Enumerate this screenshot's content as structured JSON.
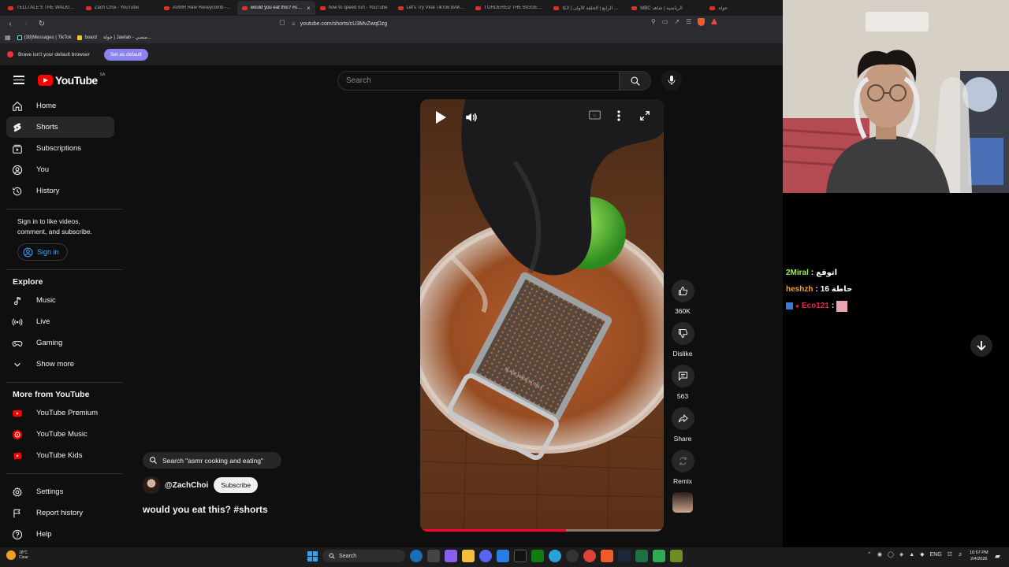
{
  "browser": {
    "tabs": [
      {
        "title": "TELLTALE'S THE WALKING DEA",
        "active": false
      },
      {
        "title": "Zach Choi - YouTube",
        "active": false
      },
      {
        "title": "ASMR Raw Honeycomb - Extr",
        "active": false
      },
      {
        "title": "would you eat this? #short",
        "active": true
      },
      {
        "title": "how to speed run - YouTube",
        "active": false
      },
      {
        "title": "Let's Try Viral TikTok BAKED P",
        "active": false
      },
      {
        "title": "I ORDERED THE BIGGEST BUR",
        "active": false
      },
      {
        "title": "الوزن الرابع | الحلقة الأولى | الكا",
        "active": false
      },
      {
        "title": "MBC الرياضية | شاهد",
        "active": false
      },
      {
        "title": "حولة",
        "active": false
      }
    ],
    "url": "youtube.com/shorts/cU3MvZwqDzg",
    "bookmarks": [
      "(38)Messages | TikTok",
      "board",
      "جولة | Jawlah - منصي..."
    ],
    "notice_text": "Brave isn't your default browser",
    "notice_button": "Set as default"
  },
  "youtube": {
    "logo_text": "YouTube",
    "country_code": "SA",
    "search_placeholder": "Search",
    "sidebar": {
      "main": [
        {
          "label": "Home",
          "icon": "home-icon",
          "active": false
        },
        {
          "label": "Shorts",
          "icon": "shorts-icon",
          "active": true
        },
        {
          "label": "Subscriptions",
          "icon": "subscriptions-icon",
          "active": false
        },
        {
          "label": "You",
          "icon": "you-icon",
          "active": false
        },
        {
          "label": "History",
          "icon": "history-icon",
          "active": false
        }
      ],
      "sign_in_text": "Sign in to like videos, comment, and subscribe.",
      "sign_in_button": "Sign in",
      "explore_title": "Explore",
      "explore": [
        {
          "label": "Music",
          "icon": "music-icon"
        },
        {
          "label": "Live",
          "icon": "live-icon"
        },
        {
          "label": "Gaming",
          "icon": "gaming-icon"
        },
        {
          "label": "Show more",
          "icon": "chevron-down-icon"
        }
      ],
      "more_title": "More from YouTube",
      "more": [
        {
          "label": "YouTube Premium",
          "icon": "youtube-premium-icon"
        },
        {
          "label": "YouTube Music",
          "icon": "youtube-music-icon"
        },
        {
          "label": "YouTube Kids",
          "icon": "youtube-kids-icon"
        }
      ],
      "footer": [
        {
          "label": "Settings",
          "icon": "settings-icon"
        },
        {
          "label": "Report history",
          "icon": "flag-icon"
        },
        {
          "label": "Help",
          "icon": "help-icon"
        }
      ]
    },
    "short": {
      "grater_text": "BLADE MADE IN ITALY",
      "progress": 0.6,
      "search_chip": "Search \"asmr cooking and eating\"",
      "channel": "@ZachChoi",
      "subscribe": "Subscribe",
      "title": "would you eat this? #shorts",
      "actions": [
        {
          "key": "like",
          "label": "360K",
          "icon": "thumbs-up-icon"
        },
        {
          "key": "dislike",
          "label": "Dislike",
          "icon": "thumbs-down-icon"
        },
        {
          "key": "comments",
          "label": "563",
          "icon": "comment-icon"
        },
        {
          "key": "share",
          "label": "Share",
          "icon": "share-icon"
        },
        {
          "key": "remix",
          "label": "Remix",
          "icon": "remix-icon"
        }
      ]
    }
  },
  "stream_chat": [
    {
      "user": "2Miral",
      "message": "اتوقع",
      "color": "#9cf24a"
    },
    {
      "user": "heshzh",
      "message": "حاطة 16",
      "color": "#f2a13a"
    },
    {
      "user": "Eco121",
      "message": "",
      "color": "#e0264a"
    }
  ],
  "taskbar": {
    "weather_temp": "18°C",
    "weather_desc": "Clear",
    "search": "Search",
    "lang": "ENG",
    "time": "10:57 PM",
    "date": "2/4/2026"
  }
}
